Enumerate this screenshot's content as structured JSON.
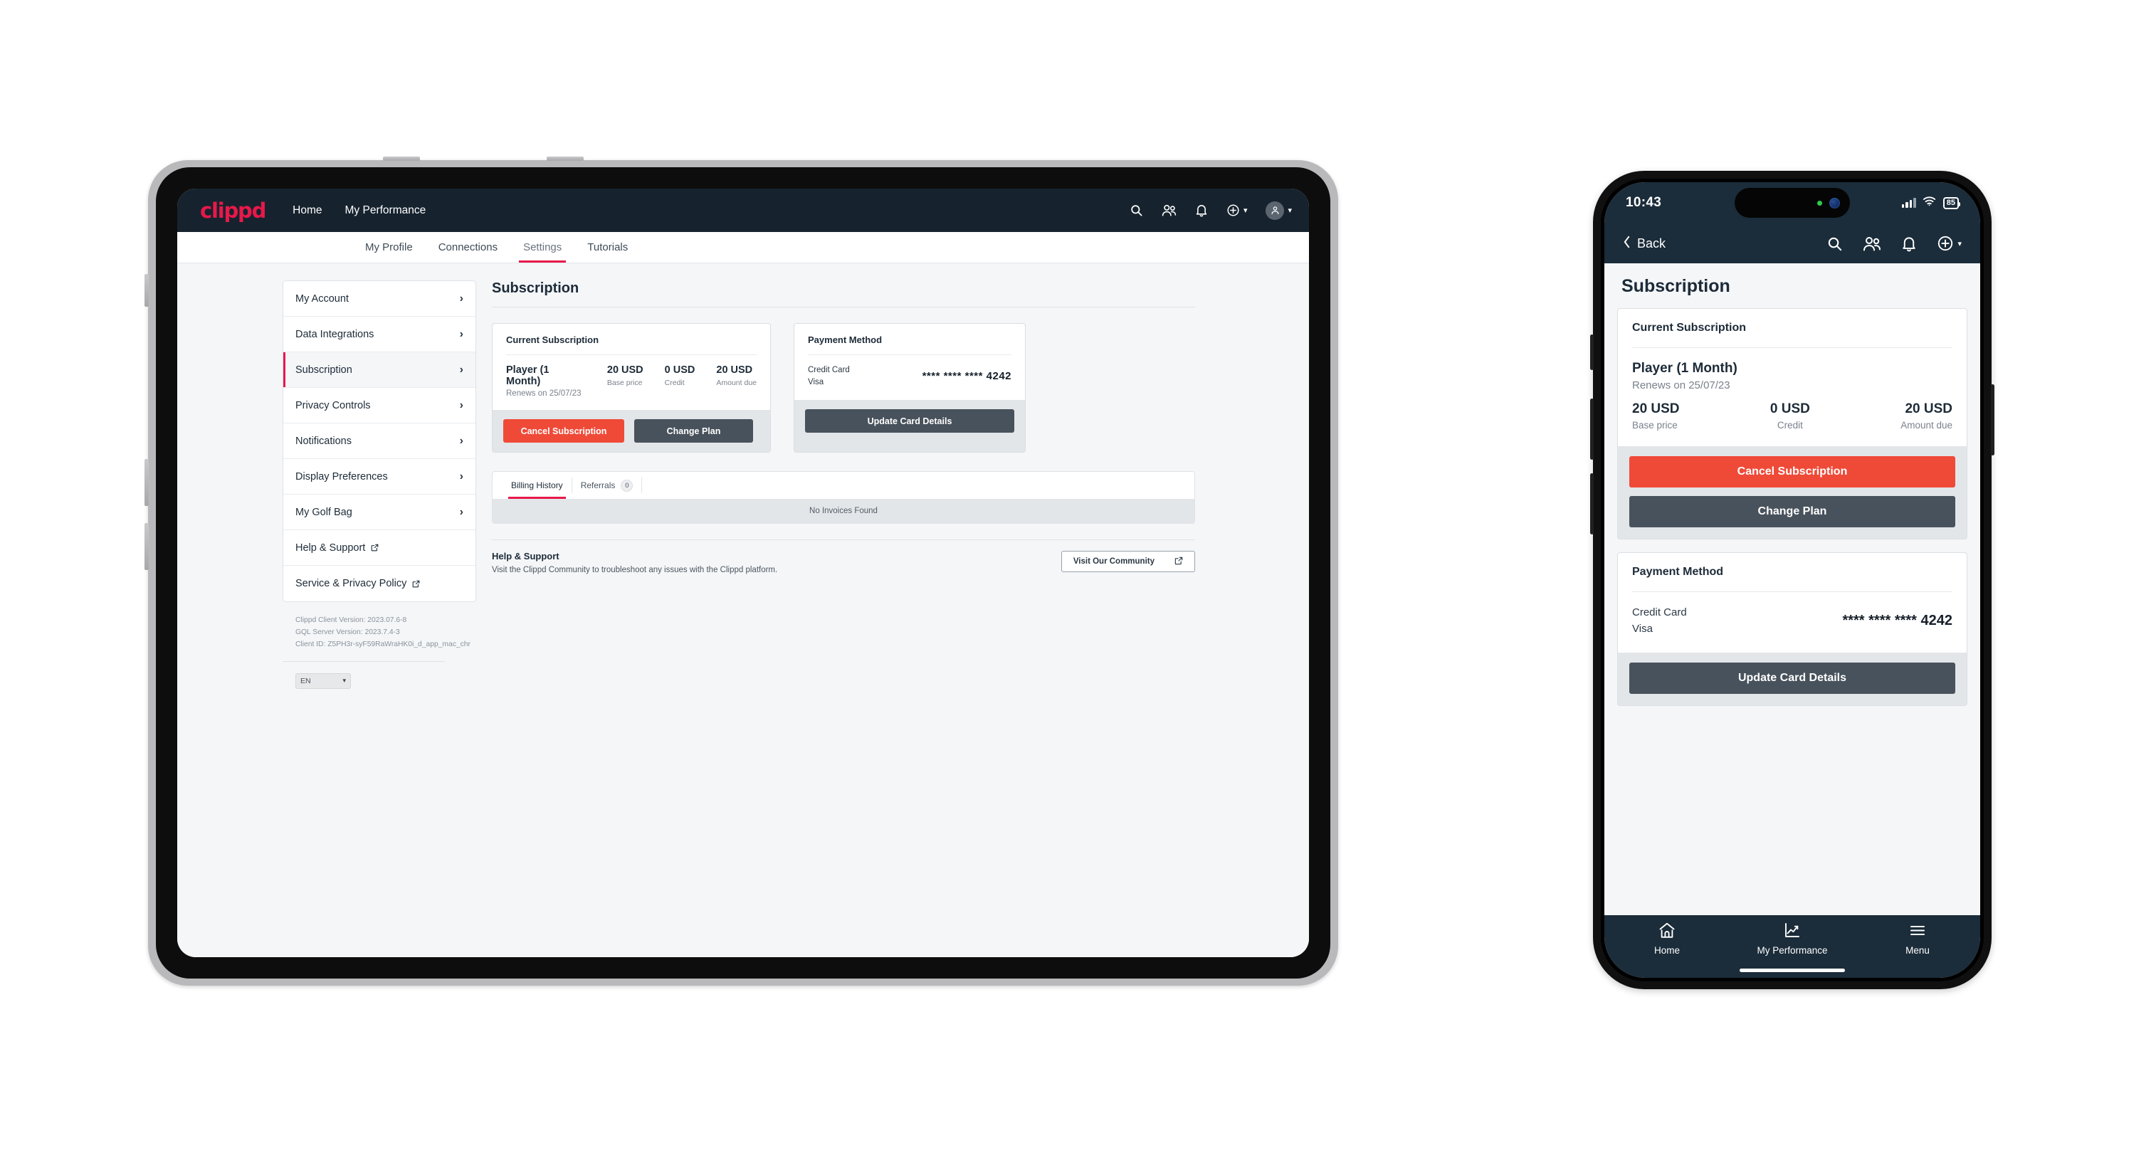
{
  "tablet": {
    "brand": "clippd",
    "topnav": [
      {
        "label": "Home"
      },
      {
        "label": "My Performance"
      }
    ],
    "topicons": [
      {
        "name": "search-icon"
      },
      {
        "name": "people-icon"
      },
      {
        "name": "bell-icon"
      },
      {
        "name": "plus-circle-icon"
      },
      {
        "name": "avatar-icon"
      }
    ],
    "subtabs": [
      {
        "label": "My Profile",
        "active": false
      },
      {
        "label": "Connections",
        "active": false
      },
      {
        "label": "Settings",
        "active": true
      },
      {
        "label": "Tutorials",
        "active": false
      }
    ],
    "sidebar": {
      "items": [
        {
          "label": "My Account",
          "active": false,
          "external": false
        },
        {
          "label": "Data Integrations",
          "active": false,
          "external": false
        },
        {
          "label": "Subscription",
          "active": true,
          "external": false
        },
        {
          "label": "Privacy Controls",
          "active": false,
          "external": false
        },
        {
          "label": "Notifications",
          "active": false,
          "external": false
        },
        {
          "label": "Display Preferences",
          "active": false,
          "external": false
        },
        {
          "label": "My Golf Bag",
          "active": false,
          "external": false
        },
        {
          "label": "Help & Support",
          "active": false,
          "external": true
        },
        {
          "label": "Service & Privacy Policy",
          "active": false,
          "external": true
        }
      ],
      "version": {
        "client": "Clippd Client Version: 2023.07.6-8",
        "server": "GQL Server Version: 2023.7.4-3",
        "client_id": "Client ID: Z5PH3r-syF59RaWraHK0i_d_app_mac_chr"
      },
      "language": "EN"
    },
    "main": {
      "page_title": "Subscription",
      "subscription_card": {
        "head": "Current Subscription",
        "plan_name": "Player (1 Month)",
        "renews": "Renews on 25/07/23",
        "metrics": [
          {
            "value": "20 USD",
            "label": "Base price"
          },
          {
            "value": "0 USD",
            "label": "Credit"
          },
          {
            "value": "20 USD",
            "label": "Amount due"
          }
        ],
        "cancel_label": "Cancel Subscription",
        "change_label": "Change Plan"
      },
      "payment_card": {
        "head": "Payment Method",
        "kind_line1": "Credit Card",
        "kind_line2": "Visa",
        "card_number": "**** **** **** 4242",
        "update_label": "Update Card Details"
      },
      "tabs": [
        {
          "label": "Billing History",
          "badge": null,
          "active": true
        },
        {
          "label": "Referrals",
          "badge": "0",
          "active": false
        }
      ],
      "empty_state": "No Invoices Found",
      "help": {
        "title": "Help & Support",
        "description": "Visit the Clippd Community to troubleshoot any issues with the Clippd platform.",
        "button_label": "Visit Our Community"
      }
    }
  },
  "phone": {
    "status": {
      "time": "10:43",
      "battery": "85"
    },
    "nav": {
      "back_label": "Back",
      "icons": [
        {
          "name": "search-icon"
        },
        {
          "name": "people-icon"
        },
        {
          "name": "bell-icon"
        },
        {
          "name": "plus-circle-icon"
        }
      ]
    },
    "page_title": "Subscription",
    "subscription_card": {
      "head": "Current Subscription",
      "plan_name": "Player (1 Month)",
      "renews": "Renews on 25/07/23",
      "metrics": [
        {
          "value": "20 USD",
          "label": "Base price"
        },
        {
          "value": "0 USD",
          "label": "Credit"
        },
        {
          "value": "20 USD",
          "label": "Amount due"
        }
      ],
      "cancel_label": "Cancel Subscription",
      "change_label": "Change Plan"
    },
    "payment_card": {
      "head": "Payment Method",
      "kind_line1": "Credit Card",
      "kind_line2": "Visa",
      "card_number": "**** **** **** 4242",
      "update_label": "Update Card Details"
    },
    "tabbar": [
      {
        "label": "Home",
        "icon": "home-icon"
      },
      {
        "label": "My Performance",
        "icon": "chart-icon"
      },
      {
        "label": "Menu",
        "icon": "hamburger-icon"
      }
    ]
  },
  "colors": {
    "brand_red": "#e8184a",
    "header_navy": "#16232e",
    "phone_navy": "#1b2c3a",
    "danger": "#ef4a38",
    "dark_button": "#48525c"
  }
}
